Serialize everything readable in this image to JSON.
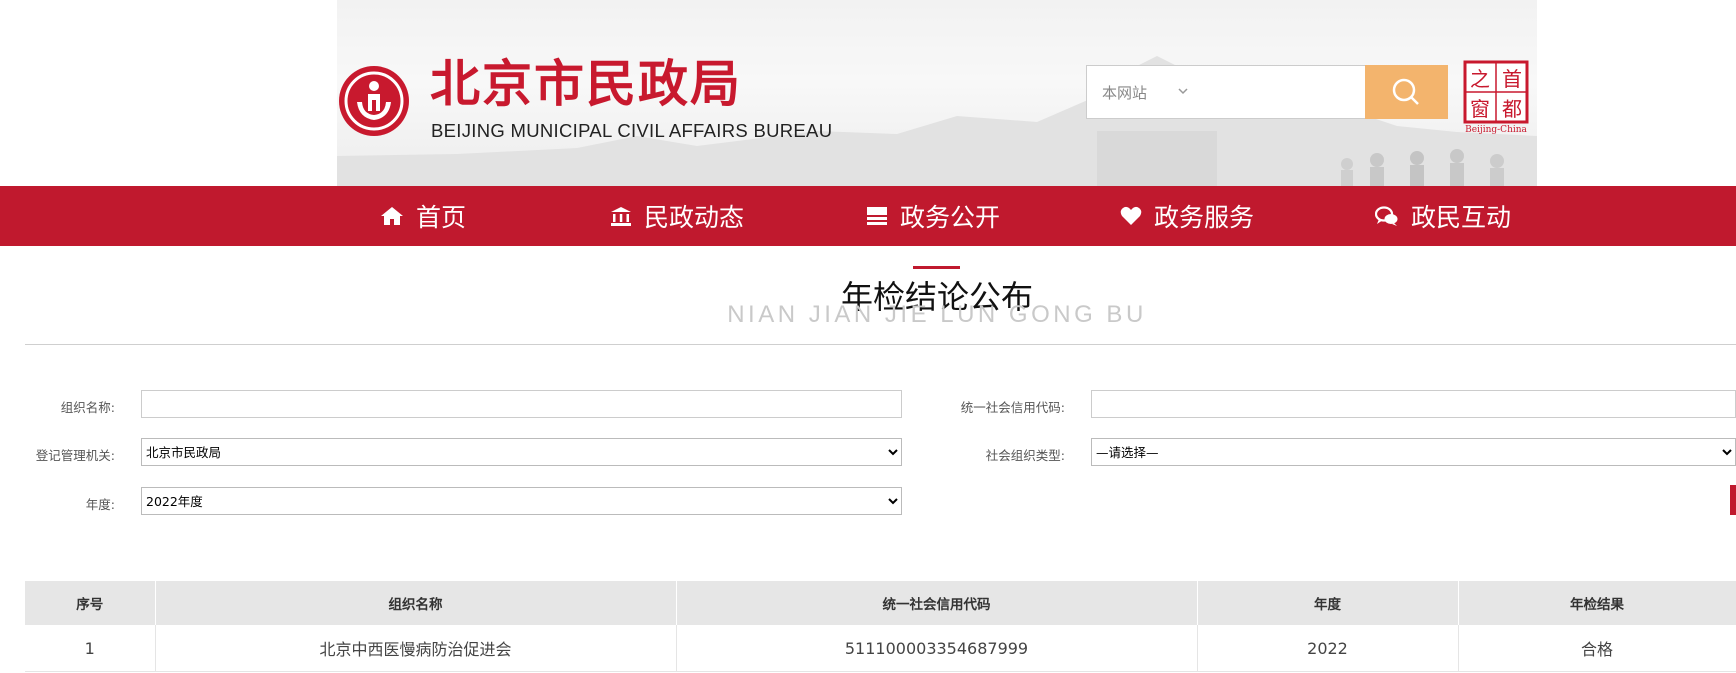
{
  "header": {
    "org_name_cn": "北京市民政局",
    "org_name_en": "BEIJING MUNICIPAL CIVIL AFFAIRS BUREAU",
    "search": {
      "scope": "本网站",
      "value": ""
    },
    "badge": {
      "chars": [
        "之",
        "首",
        "窗",
        "都"
      ],
      "caption": "Beijing-China"
    }
  },
  "nav": {
    "items": [
      {
        "label": "首页",
        "icon": "home-icon"
      },
      {
        "label": "民政动态",
        "icon": "bank-icon"
      },
      {
        "label": "政务公开",
        "icon": "document-stack-icon"
      },
      {
        "label": "政务服务",
        "icon": "heart-icon"
      },
      {
        "label": "政民互动",
        "icon": "chat-bubbles-icon"
      }
    ]
  },
  "page": {
    "title": "年检结论公布",
    "subtitle": "NIAN JIAN JIE LUN GONG BU"
  },
  "form": {
    "org_name_label": "组织名称:",
    "org_name_value": "",
    "credit_code_label": "统一社会信用代码:",
    "credit_code_value": "",
    "registrar_label": "登记管理机关:",
    "registrar_value": "北京市民政局",
    "org_type_label": "社会组织类型:",
    "org_type_value": "—请选择—",
    "year_label": "年度:",
    "year_value": "2022年度"
  },
  "table": {
    "headers": [
      "序号",
      "组织名称",
      "统一社会信用代码",
      "年度",
      "年检结果"
    ],
    "rows": [
      [
        "1",
        "北京中西医慢病防治促进会",
        "511100003354687999",
        "2022",
        "合格"
      ]
    ]
  },
  "colors": {
    "brand_red": "#c0192e",
    "search_button": "#f3b46d"
  }
}
